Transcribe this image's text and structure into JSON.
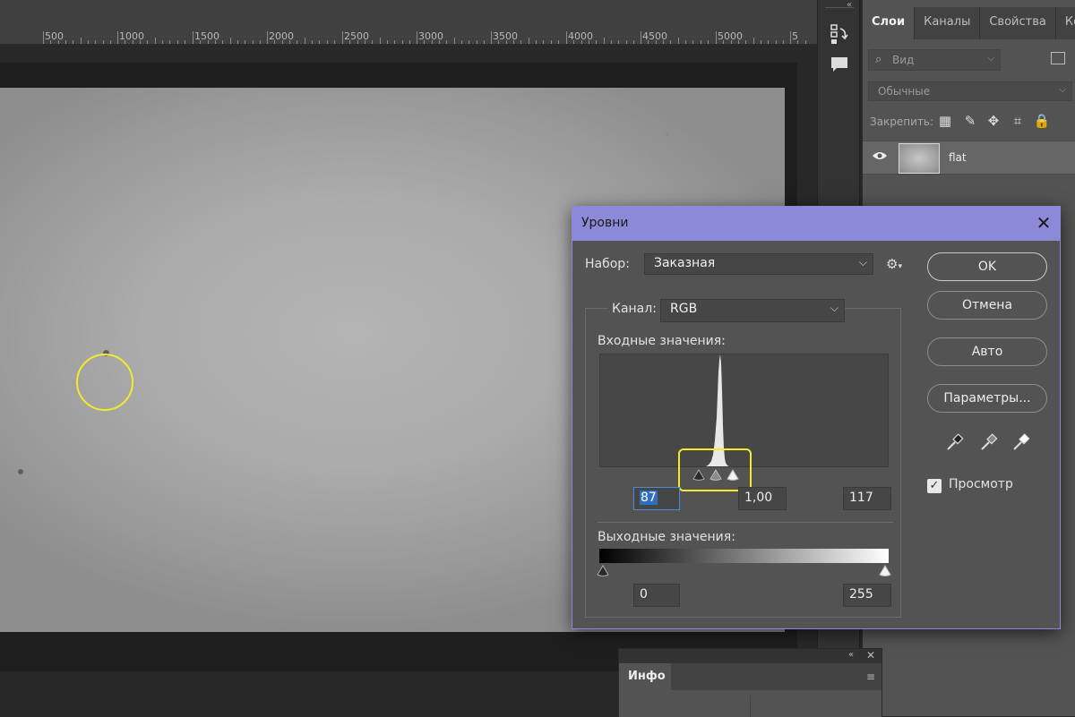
{
  "ruler": {
    "labels": [
      "500",
      "1000",
      "1500",
      "2000",
      "2500",
      "3000",
      "3500",
      "4000",
      "4500",
      "5000",
      "5"
    ]
  },
  "layers_panel": {
    "tabs": [
      {
        "label": "Слои",
        "active": true
      },
      {
        "label": "Каналы",
        "active": false
      },
      {
        "label": "Свойства",
        "active": false
      },
      {
        "label": "Корр",
        "active": false
      }
    ],
    "filter_placeholder": "Вид",
    "blend_mode": "Обычные",
    "lock_label": "Закрепить:",
    "layer": {
      "name": "flat",
      "visible": true
    }
  },
  "info_panel": {
    "tab_label": "Инфо"
  },
  "levels_dialog": {
    "title": "Уровни",
    "preset_label": "Набор:",
    "preset_value": "Заказная",
    "channel_label": "Канал:",
    "channel_value": "RGB",
    "input_levels_label": "Входные значения:",
    "output_levels_label": "Выходные значения:",
    "input_black": "87",
    "input_gamma": "1,00",
    "input_white": "117",
    "output_black": "0",
    "output_white": "255",
    "buttons": {
      "ok": "OK",
      "cancel": "Отмена",
      "auto": "Авто",
      "options": "Параметры..."
    },
    "preview_label": "Просмотр",
    "preview_checked": true
  },
  "colors": {
    "dialog_titlebar": "#8c89d9",
    "highlight": "#f0ec2a",
    "selection": "#2f6fbf"
  }
}
